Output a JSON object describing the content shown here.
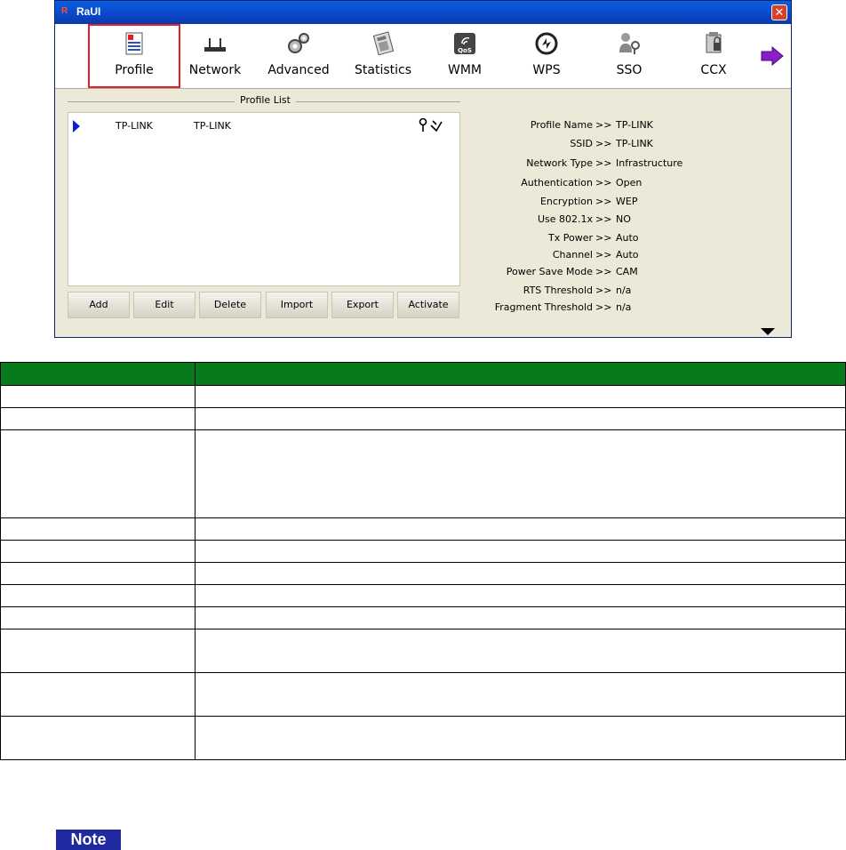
{
  "window": {
    "title": "RaUI",
    "logo": "R"
  },
  "toolbar": {
    "items": [
      {
        "label": "Profile",
        "icon": "profile-icon"
      },
      {
        "label": "Network",
        "icon": "network-icon"
      },
      {
        "label": "Advanced",
        "icon": "advanced-icon"
      },
      {
        "label": "Statistics",
        "icon": "statistics-icon"
      },
      {
        "label": "WMM",
        "icon": "wmm-qos-icon"
      },
      {
        "label": "WPS",
        "icon": "wps-icon"
      },
      {
        "label": "SSO",
        "icon": "sso-icon"
      },
      {
        "label": "CCX",
        "icon": "ccx-icon"
      }
    ],
    "selected": "Profile"
  },
  "profile_list": {
    "title": "Profile List",
    "rows": [
      {
        "profile": "TP-LINK",
        "ssid": "TP-LINK"
      }
    ]
  },
  "buttons": [
    "Add",
    "Edit",
    "Delete",
    "Import",
    "Export",
    "Activate"
  ],
  "details": [
    {
      "key": "Profile Name",
      "sep": ">>",
      "value": "TP-LINK"
    },
    {
      "key": "SSID",
      "sep": ">>",
      "value": "TP-LINK"
    },
    {
      "key": "Network Type",
      "sep": ">>",
      "value": "Infrastructure"
    },
    {
      "key": "Authentication",
      "sep": ">>",
      "value": "Open"
    },
    {
      "key": "Encryption",
      "sep": ">>",
      "value": "WEP"
    },
    {
      "key": "Use 802.1x",
      "sep": ">>",
      "value": "NO"
    },
    {
      "key": "Tx Power",
      "sep": ">>",
      "value": "Auto"
    },
    {
      "key": "Channel",
      "sep": ">>",
      "value": "Auto"
    },
    {
      "key": "Power Save Mode",
      "sep": ">>",
      "value": "CAM"
    },
    {
      "key": "RTS Threshold",
      "sep": ">>",
      "value": "n/a"
    },
    {
      "key": "Fragment Threshold",
      "sep": ">>",
      "value": "n/a"
    }
  ],
  "note": {
    "label": "Note"
  },
  "colors": {
    "header_green": "#087a1c",
    "note_blue": "#1f2aa0",
    "select_red": "#e0202a"
  }
}
